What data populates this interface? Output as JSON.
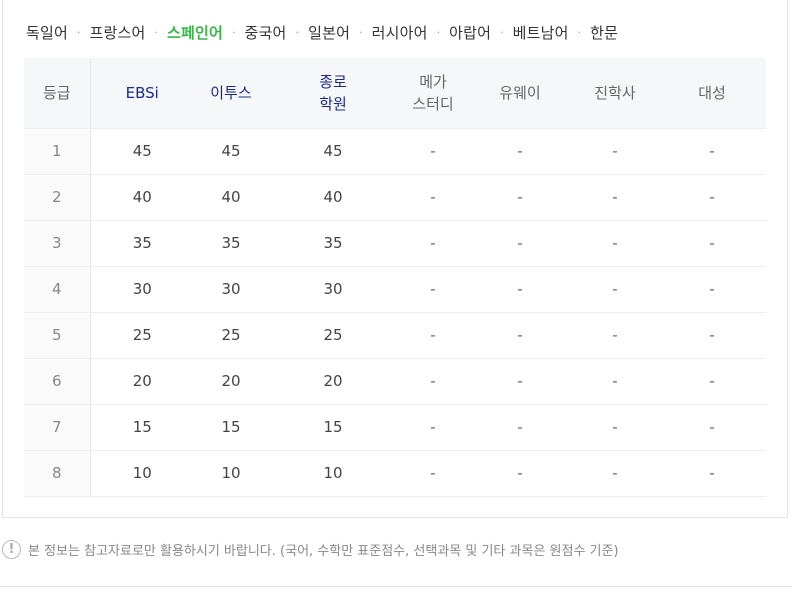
{
  "tabs": [
    {
      "label": "독일어",
      "active": false
    },
    {
      "label": "프랑스어",
      "active": false
    },
    {
      "label": "스페인어",
      "active": true
    },
    {
      "label": "중국어",
      "active": false
    },
    {
      "label": "일본어",
      "active": false
    },
    {
      "label": "러시아어",
      "active": false
    },
    {
      "label": "아랍어",
      "active": false
    },
    {
      "label": "베트남어",
      "active": false
    },
    {
      "label": "한문",
      "active": false
    }
  ],
  "tab_separator": "·",
  "table": {
    "headers": {
      "grade": "등급",
      "ebsi": "EBSi",
      "etoos": "이투스",
      "jongro_line1": "종로",
      "jongro_line2": "학원",
      "mega_line1": "메가",
      "mega_line2": "스터디",
      "uway": "유웨이",
      "jinhak": "진학사",
      "daesung": "대성"
    },
    "rows": [
      {
        "grade": "1",
        "ebsi": "45",
        "etoos": "45",
        "jongro": "45",
        "mega": "-",
        "uway": "-",
        "jinhak": "-",
        "daesung": "-"
      },
      {
        "grade": "2",
        "ebsi": "40",
        "etoos": "40",
        "jongro": "40",
        "mega": "-",
        "uway": "-",
        "jinhak": "-",
        "daesung": "-"
      },
      {
        "grade": "3",
        "ebsi": "35",
        "etoos": "35",
        "jongro": "35",
        "mega": "-",
        "uway": "-",
        "jinhak": "-",
        "daesung": "-"
      },
      {
        "grade": "4",
        "ebsi": "30",
        "etoos": "30",
        "jongro": "30",
        "mega": "-",
        "uway": "-",
        "jinhak": "-",
        "daesung": "-"
      },
      {
        "grade": "5",
        "ebsi": "25",
        "etoos": "25",
        "jongro": "25",
        "mega": "-",
        "uway": "-",
        "jinhak": "-",
        "daesung": "-"
      },
      {
        "grade": "6",
        "ebsi": "20",
        "etoos": "20",
        "jongro": "20",
        "mega": "-",
        "uway": "-",
        "jinhak": "-",
        "daesung": "-"
      },
      {
        "grade": "7",
        "ebsi": "15",
        "etoos": "15",
        "jongro": "15",
        "mega": "-",
        "uway": "-",
        "jinhak": "-",
        "daesung": "-"
      },
      {
        "grade": "8",
        "ebsi": "10",
        "etoos": "10",
        "jongro": "10",
        "mega": "-",
        "uway": "-",
        "jinhak": "-",
        "daesung": "-"
      }
    ]
  },
  "notice": {
    "icon": "exclamation-circle-icon",
    "icon_glyph": "!",
    "text": "본 정보는 참고자료로만 활용하시기 바랍니다. (국어, 수학만 표준점수, 선택과목 및 기타 과목은 원점수 기준)"
  },
  "colors": {
    "active_tab": "#3ab54a",
    "highlight_header": "#1a2a8c",
    "header_bg": "#f6f7f9"
  }
}
